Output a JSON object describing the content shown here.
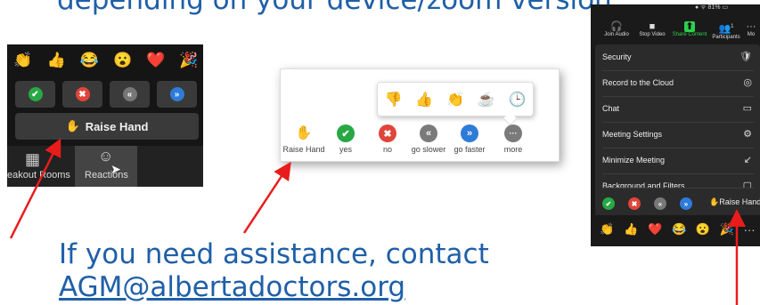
{
  "header": {
    "text": "depending on your device/zoom version."
  },
  "footer": {
    "line1": "If you need assistance, contact",
    "email": "AGM@albertadoctors.org"
  },
  "panel1": {
    "emojis": [
      "👏",
      "👍",
      "😂",
      "😮",
      "❤️",
      "🎉"
    ],
    "buttons": [
      {
        "icon": "✔",
        "color": "#27a844"
      },
      {
        "icon": "✖",
        "color": "#e0453a"
      },
      {
        "icon": "«",
        "color": "#777777"
      },
      {
        "icon": "»",
        "color": "#2e7bd8"
      }
    ],
    "raise_hand": "Raise Hand",
    "breakout_label": "eakout Rooms",
    "reactions_label": "Reactions"
  },
  "panel2": {
    "items": [
      {
        "label": "Raise Hand",
        "icon": "✋",
        "color": "#2e7bd8"
      },
      {
        "label": "yes",
        "icon": "✔",
        "color": "#27a844"
      },
      {
        "label": "no",
        "icon": "✖",
        "color": "#e0453a"
      },
      {
        "label": "go slower",
        "icon": "«",
        "color": "#7a7a7a"
      },
      {
        "label": "go faster",
        "icon": "»",
        "color": "#2e7bd8"
      },
      {
        "label": "more",
        "icon": "···",
        "color": "#7a7a7a"
      }
    ],
    "popup_icons": [
      "thumbs-down-icon",
      "thumbs-up-icon",
      "clap-icon",
      "coffee-icon",
      "clock-icon"
    ]
  },
  "panel3": {
    "status": "81%",
    "toolbar": [
      {
        "label": "Join Audio",
        "icon": "🎧"
      },
      {
        "label": "Stop Video",
        "icon": "■"
      },
      {
        "label": "Share Content",
        "icon": "⬆"
      },
      {
        "label": "Participants",
        "icon": "👥"
      },
      {
        "label": "Mo",
        "icon": "···"
      }
    ],
    "participants_count": "1",
    "menu": [
      {
        "label": "Security",
        "icon": "🛡"
      },
      {
        "label": "Record to the Cloud",
        "icon": "◎"
      },
      {
        "label": "Chat",
        "icon": "▭"
      },
      {
        "label": "Meeting Settings",
        "icon": "⚙"
      },
      {
        "label": "Minimize Meeting",
        "icon": "↙"
      },
      {
        "label": "Background and Filters",
        "icon": "▢"
      }
    ],
    "raise_hand": "Raise Hand",
    "emojis": [
      "👏",
      "👍",
      "❤️",
      "😂",
      "😮",
      "🎉",
      "···"
    ]
  }
}
